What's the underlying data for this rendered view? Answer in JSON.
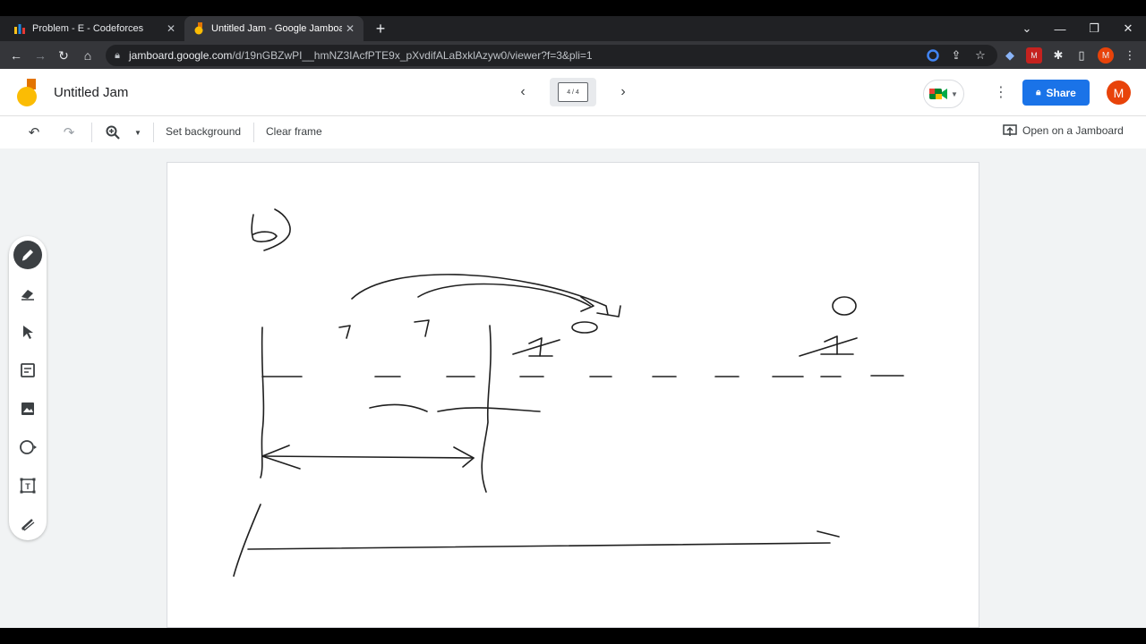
{
  "browser": {
    "tabs": [
      {
        "title": "Problem - E - Codeforces",
        "active": false
      },
      {
        "title": "Untitled Jam - Google Jamboard",
        "active": true
      }
    ],
    "url_host": "jamboard.google.com",
    "url_path": "/d/19nGBZwPI__hmNZ3IAcfPTE9x_pXvdifALaBxklAzyw0/viewer?f=3&pli=1",
    "profile_initial": "M"
  },
  "app": {
    "title": "Untitled Jam",
    "frame_indicator": "4 / 4",
    "share_label": "Share",
    "avatar_initial": "M",
    "accent_color": "#1a73e8"
  },
  "toolbar": {
    "set_background": "Set background",
    "clear_frame": "Clear frame",
    "open_on_jamboard": "Open on a Jamboard"
  },
  "tools": [
    "pen-icon",
    "eraser-icon",
    "select-icon",
    "sticky-note-icon",
    "image-icon",
    "circle-icon",
    "text-box-icon",
    "laser-icon"
  ],
  "canvas_handwriting": {
    "label_b": "b)",
    "marks": [
      "7",
      "7",
      "1",
      "0",
      "1",
      "0"
    ]
  }
}
